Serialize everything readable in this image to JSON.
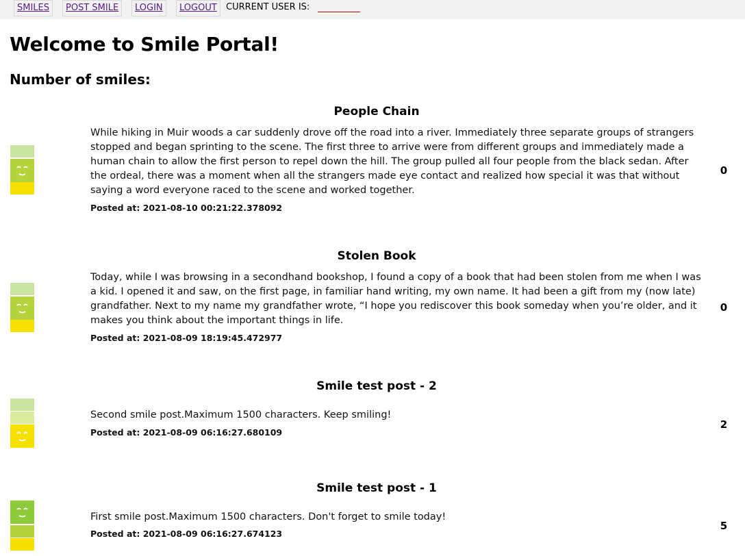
{
  "nav": {
    "items": [
      "SMILES",
      "POST SMILE",
      "LOGIN",
      "LOGOUT"
    ],
    "current_user_label": "CURRENT USER IS:",
    "current_user_value": ""
  },
  "page": {
    "title": "Welcome to Smile Portal!",
    "subtitle": "Number of smiles:"
  },
  "posts": [
    {
      "title": "People Chain",
      "body": "While hiking in Muir woods a car suddenly drove off the road into a river. Immediately three separate groups of strangers stopped and began sprinting to the scene. The first three to arrive were from different groups and immediately made a human chain to allow the first person to repel down the hill. The group pulled all four people from the black sedan. After the ordeal, there was a moment when all the strangers made eye contact and realized how special it was that without saying a word everyone raced to the scene and worked together.",
      "date": "Posted at: 2021-08-10 00:21:22.378092",
      "count": "0",
      "meter_colors": [
        "#c9e4a0",
        "#b5d33d",
        "#f5e000"
      ]
    },
    {
      "title": "Stolen Book",
      "body": "Today, while I was browsing in a secondhand bookshop, I found a copy of a book that had been stolen from me when I was a kid. I opened it and saw, on the first page, in familiar hand writing, my own name. It had been a gift from my (now late) grandfather. Next to my name my grandfather wrote, “I hope you rediscover this book someday when you’re older, and it makes you think about the important things in life.",
      "date": "Posted at: 2021-08-09 18:19:45.472977",
      "count": "0",
      "meter_colors": [
        "#c9e4a0",
        "#b5d33d",
        "#f5e000"
      ]
    },
    {
      "title": "Smile test post - 2",
      "body": "Second smile post.Maximum 1500 characters. Keep smiling!",
      "date": "Posted at: 2021-08-09 06:16:27.680109",
      "count": "2",
      "meter_colors": [
        "#c9e4a0",
        "#dcec9e",
        "#f5e000"
      ]
    },
    {
      "title": "Smile test post - 1",
      "body": "First smile post.Maximum 1500 characters. Don't forget to smile today!",
      "date": "Posted at: 2021-08-09 06:16:27.674123",
      "count": "5",
      "meter_colors": [
        "#8ecb3a",
        "#b5d33d",
        "#f5e000"
      ]
    }
  ]
}
